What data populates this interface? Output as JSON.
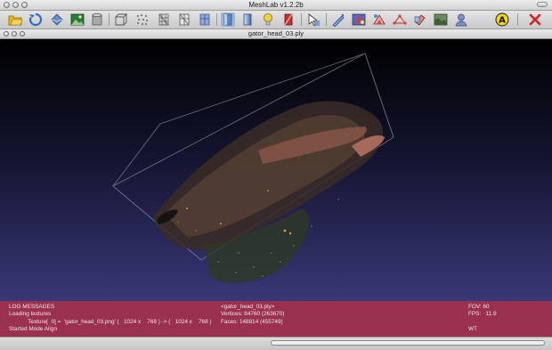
{
  "window": {
    "title": "MeshLab v1.2.2b"
  },
  "document": {
    "title": "gator_head_03.ply"
  },
  "toolbar": {
    "buttons": [
      {
        "name": "open-icon",
        "color": "#e2b91f"
      },
      {
        "name": "reload-icon",
        "color": "#2f6fb8"
      },
      {
        "name": "import-icon",
        "color": "#3c5f9a"
      },
      {
        "name": "snapshot-icon",
        "color": "#2c7b38"
      },
      {
        "name": "cylinder-icon",
        "color": "#9a9a9a"
      },
      {
        "name": "box-icon",
        "color": "#777777"
      },
      {
        "name": "points-icon",
        "color": "#555555"
      },
      {
        "name": "wireframe-icon",
        "color": "#666666"
      },
      {
        "name": "hidden-lines-icon",
        "color": "#666666"
      },
      {
        "name": "flat-lines-icon",
        "color": "#4d74b4"
      },
      {
        "name": "flat-icon",
        "color": "#4d74b4"
      },
      {
        "name": "smooth-icon",
        "color": "#4d74b4"
      },
      {
        "name": "light-icon",
        "color": "#f0d23a"
      },
      {
        "name": "color-icon",
        "color": "#c9302e"
      },
      {
        "name": "select-icon",
        "color": "#4b78c2"
      },
      {
        "name": "measure-icon",
        "color": "#4b78c2"
      },
      {
        "name": "paint-icon",
        "color": "#cf3c46"
      },
      {
        "name": "select-faces-icon",
        "color": "#cf4c4c"
      },
      {
        "name": "select-vertices-icon",
        "color": "#c94545"
      },
      {
        "name": "align-icon",
        "color": "#c25555"
      },
      {
        "name": "texture-icon",
        "color": "#4e7a52"
      },
      {
        "name": "user-icon",
        "color": "#5f77aa"
      },
      {
        "name": "annotation-icon",
        "color": "#f2d323"
      },
      {
        "name": "delete-icon",
        "color": "#d42020"
      }
    ],
    "annotation_letter": "A"
  },
  "log": {
    "header": "LOG MESSAGES",
    "lines": [
      "Loading textures",
      "            Texture[  0] =  'gator_head_03.png' (   1024 x    768 ) -> (   1024 x    768 )",
      "Started Mode Align"
    ]
  },
  "mesh_info": {
    "name": "<gator_head_03.ply>",
    "vertices": "Vertices: 84760 (263670)",
    "faces": "Faces: 148814 (455749)"
  },
  "render_info": {
    "fov": "FOV: 60",
    "fps": "FPS:   11.9",
    "mode": "WT"
  },
  "colors": {
    "viewport_top": "#000000",
    "viewport_bottom": "#383877",
    "info_panel": "#9a314f",
    "bbox": "#8a8f9a"
  }
}
